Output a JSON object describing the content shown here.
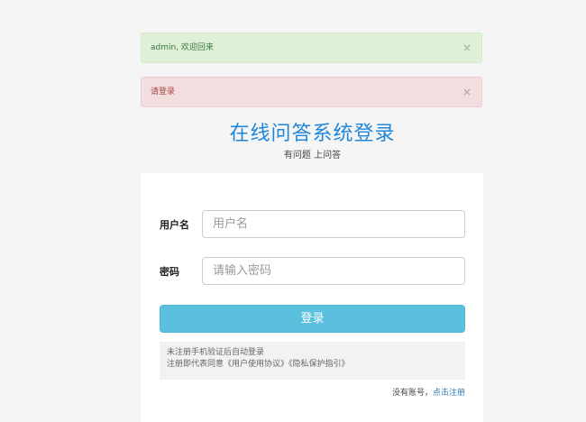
{
  "alerts": {
    "success": {
      "text": "admin, 欢迎回来",
      "close": "×"
    },
    "danger": {
      "text": "请登录",
      "close": "×"
    }
  },
  "header": {
    "title": "在线问答系统登录",
    "subtitle": "有问题 上问答"
  },
  "form": {
    "username_label": "用户名",
    "username_placeholder": "用户名",
    "username_value": "",
    "password_label": "密码",
    "password_placeholder": "请输入密码",
    "password_value": "",
    "login_button": "登录"
  },
  "notice": {
    "line1": "未注册手机验证后自动登录",
    "line2": "注册即代表同意《用户使用协议》《隐私保护指引》"
  },
  "register": {
    "prefix": "没有账号，",
    "link": "点击注册"
  },
  "colors": {
    "title": "#1f86d9",
    "button": "#5bc0de",
    "link": "#337ab7",
    "success_bg": "#dff0d8",
    "danger_bg": "#f2dede"
  }
}
